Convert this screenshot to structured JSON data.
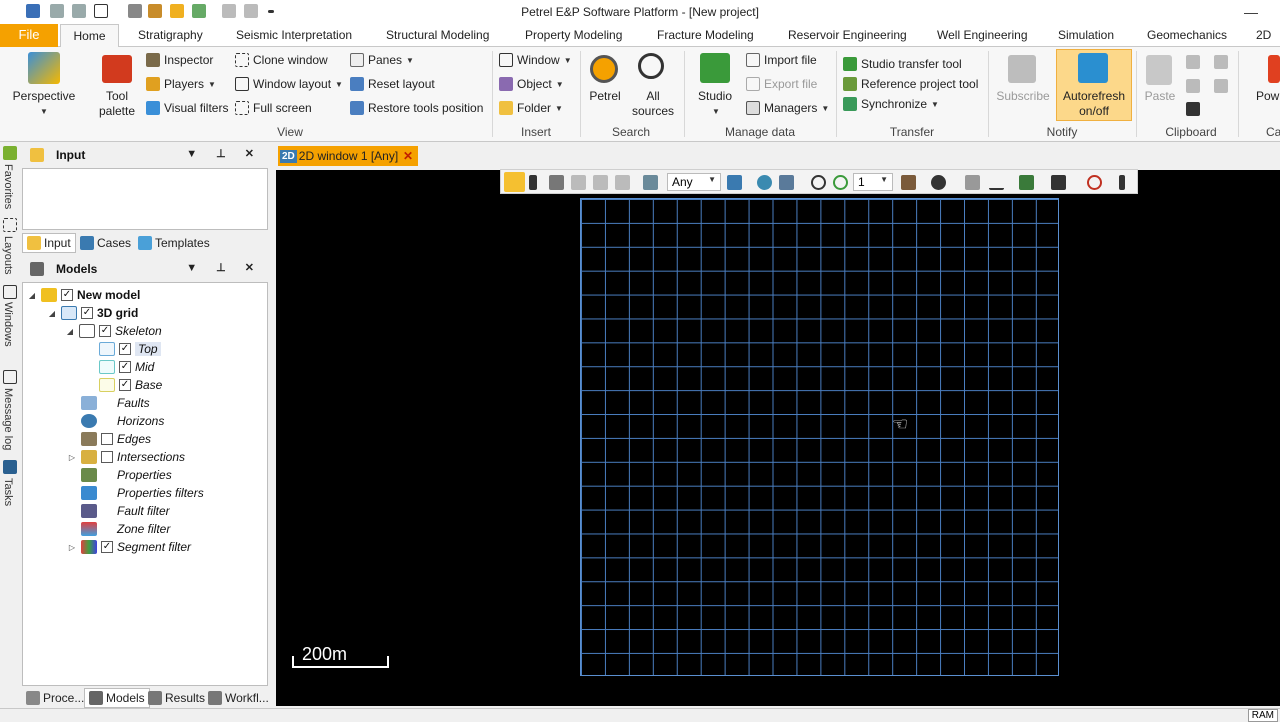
{
  "window": {
    "title": "Petrel E&P Software Platform - [New project]",
    "minimize": "—"
  },
  "ribbon_tabs": [
    "File",
    "Home",
    "Stratigraphy",
    "Seismic Interpretation",
    "Structural Modeling",
    "Property Modeling",
    "Fracture Modeling",
    "Reservoir Engineering",
    "Well Engineering",
    "Simulation",
    "Geomechanics",
    "2D"
  ],
  "ribbon": {
    "perspective": "Perspective",
    "tool_palette": [
      "Tool",
      "palette"
    ],
    "inspector": "Inspector",
    "players": "Players",
    "visual_filters": "Visual filters",
    "clone_window": "Clone window",
    "window_layout": "Window layout",
    "full_screen": "Full screen",
    "panes": "Panes",
    "reset_layout": "Reset layout",
    "restore_tools": "Restore tools position",
    "view_group": "View",
    "window": "Window",
    "object": "Object",
    "folder": "Folder",
    "insert_group": "Insert",
    "petrel": "Petrel",
    "all_sources": [
      "All",
      "sources"
    ],
    "search_group": "Search",
    "studio": "Studio",
    "import_file": "Import file",
    "export_file": "Export file",
    "managers": "Managers",
    "manage_group": "Manage data",
    "studio_transfer": "Studio transfer tool",
    "reference_project": "Reference project tool",
    "synchronize": "Synchronize",
    "transfer_group": "Transfer",
    "subscribe": "Subscribe",
    "autorefresh": [
      "Autorefresh",
      "on/off"
    ],
    "notify_group": "Notify",
    "paste": "Paste",
    "clipboard_group": "Clipboard",
    "pow": "Pow",
    "ca": "Ca"
  },
  "side_strip": [
    "Favorites",
    "Layouts",
    "Windows",
    "Message log",
    "Tasks"
  ],
  "input_panel": {
    "title": "Input",
    "tabs": [
      "Input",
      "Cases",
      "Templates"
    ]
  },
  "models_panel": {
    "title": "Models",
    "tree": [
      {
        "label": "New model"
      },
      {
        "label": "3D grid"
      },
      {
        "label": "Skeleton"
      },
      {
        "label": "Top"
      },
      {
        "label": "Mid"
      },
      {
        "label": "Base"
      },
      {
        "label": "Faults"
      },
      {
        "label": "Horizons"
      },
      {
        "label": "Edges"
      },
      {
        "label": "Intersections"
      },
      {
        "label": "Properties"
      },
      {
        "label": "Properties filters"
      },
      {
        "label": "Fault filter"
      },
      {
        "label": "Zone filter"
      },
      {
        "label": "Segment filter"
      }
    ]
  },
  "bottom_tabs": [
    "Proce...",
    "Models",
    "Results",
    "Workfl..."
  ],
  "document": {
    "tab_label": "2D window 1 [Any]",
    "tab_badge": "2D",
    "toolbar": {
      "domain_value": "Any",
      "zoom_value": "1"
    },
    "scale_label": "200m"
  },
  "status": {
    "ram": "RAM"
  },
  "colors": {
    "accent": "#f5a100",
    "grid": "#4a7ec0",
    "canvas": "#000000"
  }
}
